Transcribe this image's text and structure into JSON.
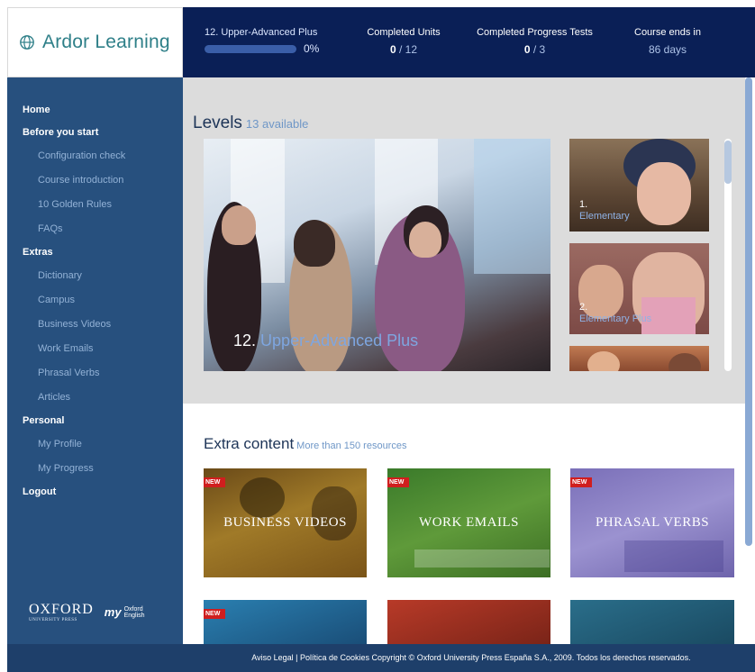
{
  "app": {
    "logo_text": "Ardor Learning"
  },
  "topbar": {
    "level_name": "12. Upper-Advanced Plus",
    "level_progress_label": "0%",
    "level_progress": 0,
    "completed_units_label": "Completed Units",
    "completed_units_done": "0",
    "completed_units_total": " / 12",
    "completed_tests_label": "Completed Progress Tests",
    "completed_tests_done": "0",
    "completed_tests_total": " / 3",
    "course_ends_label": "Course ends in",
    "course_ends_value": "86 days"
  },
  "sidebar": {
    "items": [
      {
        "label": "Home",
        "type": "section"
      },
      {
        "label": "Before you start",
        "type": "section"
      },
      {
        "label": "Configuration check",
        "type": "sub"
      },
      {
        "label": "Course introduction",
        "type": "sub"
      },
      {
        "label": "10 Golden Rules",
        "type": "sub"
      },
      {
        "label": "FAQs",
        "type": "sub"
      },
      {
        "label": "Extras",
        "type": "section"
      },
      {
        "label": "Dictionary",
        "type": "sub"
      },
      {
        "label": "Campus",
        "type": "sub"
      },
      {
        "label": "Business Videos",
        "type": "sub"
      },
      {
        "label": "Work Emails",
        "type": "sub"
      },
      {
        "label": "Phrasal Verbs",
        "type": "sub"
      },
      {
        "label": "Articles",
        "type": "sub"
      },
      {
        "label": "Personal",
        "type": "section"
      },
      {
        "label": "My Profile",
        "type": "sub"
      },
      {
        "label": "My Progress",
        "type": "sub"
      },
      {
        "label": "Logout",
        "type": "section"
      }
    ],
    "oxford_word": "OXFORD",
    "oxford_sub": "UNIVERSITY PRESS",
    "my_text": "my",
    "oxford_english_1": "Oxford",
    "oxford_english_2": "English"
  },
  "levels": {
    "title": "Levels",
    "available": "13 available",
    "featured": {
      "number": "12.",
      "name": "Upper-Advanced Plus"
    },
    "thumbs": [
      {
        "number": "1.",
        "name": "Elementary"
      },
      {
        "number": "2.",
        "name": "Elementary Plus"
      }
    ]
  },
  "extra": {
    "title": "Extra content",
    "subtitle": "More than 150 resources",
    "new_badge": "NEW",
    "cards": [
      {
        "label": "BUSINESS VIDEOS"
      },
      {
        "label": "WORK EMAILS"
      },
      {
        "label": "PHRASAL VERBS"
      }
    ]
  },
  "footer": {
    "text": "Aviso Legal | Política de Cookies Copyright © Oxford University Press España S.A., 2009. Todos los derechos reservados."
  },
  "colors": {
    "topbar": "#0a1f56",
    "sidebar": "#27507e",
    "accent": "#2e7f88",
    "badge": "#d01e1e"
  }
}
